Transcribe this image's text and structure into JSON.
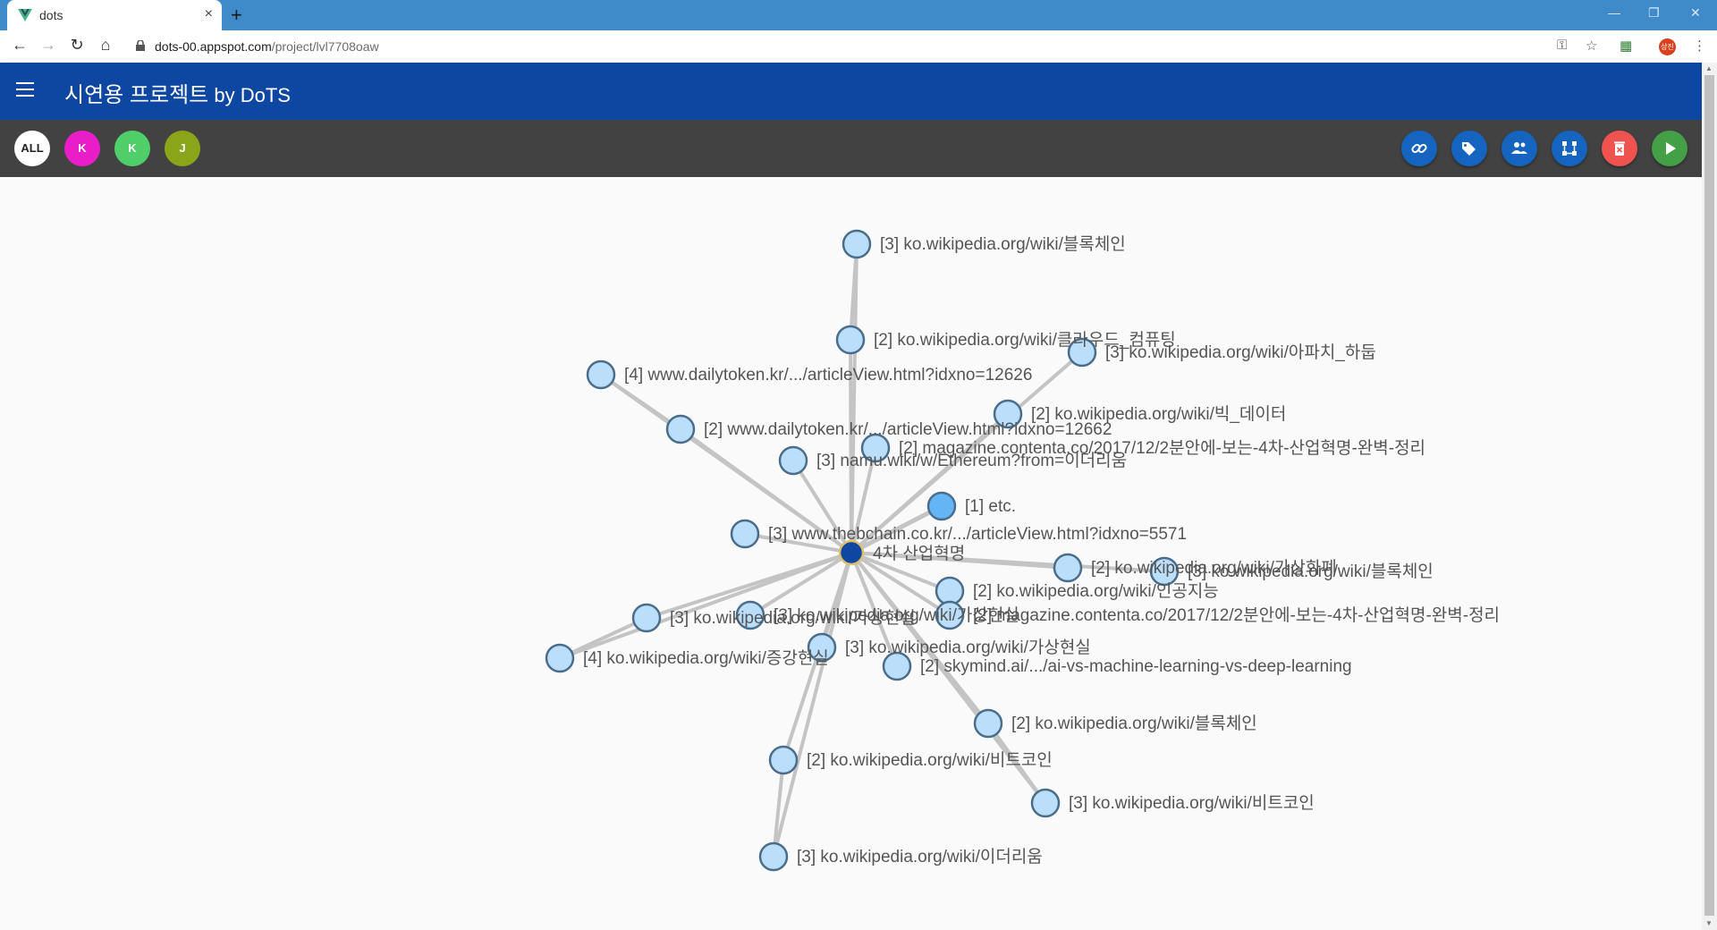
{
  "browser": {
    "tab_title": "dots",
    "tab_close": "×",
    "new_tab": "+",
    "url_host": "dots-00.appspot.com",
    "url_path": "/project/lvl7708oaw",
    "profile_initials": "상진"
  },
  "app": {
    "title_main": "시연용 프로젝트",
    "title_by": " by DoTS"
  },
  "filters": [
    {
      "label": "ALL",
      "color": "#ffffff",
      "text_color": "#222222"
    },
    {
      "label": "K",
      "color": "#e91ec9",
      "text_color": "#ffffff"
    },
    {
      "label": "K",
      "color": "#4fce6a",
      "text_color": "#ffffff"
    },
    {
      "label": "J",
      "color": "#8aa51a",
      "text_color": "#ffffff"
    }
  ],
  "actions": [
    {
      "name": "link-icon",
      "color": "#1565c0"
    },
    {
      "name": "tags-icon",
      "color": "#1565c0"
    },
    {
      "name": "people-icon",
      "color": "#1565c0"
    },
    {
      "name": "flow-icon",
      "color": "#1565c0"
    },
    {
      "name": "delete-icon",
      "color": "#ef5350"
    },
    {
      "name": "play-icon",
      "color": "#43a047"
    }
  ],
  "graph": {
    "center": {
      "label": "4차 산업혁명"
    },
    "nodes": [
      {
        "label": "[3] ko.wikipedia.org/wiki/블록체인",
        "parent": "center",
        "level": 2
      },
      {
        "label": "[2] ko.wikipedia.org/wiki/클라우드_컴퓨팅",
        "parent": "center",
        "level": 2
      },
      {
        "label": "[3] ko.wikipedia.org/wiki/아파치_하둡",
        "parent": "center",
        "level": 2
      },
      {
        "label": "[4] www.dailytoken.kr/.../articleView.html?idxno=12626",
        "parent": "center",
        "level": 2
      },
      {
        "label": "[2] ko.wikipedia.org/wiki/빅_데이터",
        "parent": "center",
        "level": 2
      },
      {
        "label": "[2] www.dailytoken.kr/.../articleView.html?idxno=12662",
        "parent": "center",
        "level": 2
      },
      {
        "label": "[2] magazine.contenta.co/2017/12/2분안에-보는-4차-산업혁명-완벽-정리",
        "parent": "center",
        "level": 2
      },
      {
        "label": "[3] namu.wiki/w/Ethereum?from=이더리움",
        "parent": "center",
        "level": 2
      },
      {
        "label": "[1] etc.",
        "parent": "center",
        "level": 1
      },
      {
        "label": "[3] www.thebchain.co.kr/.../articleView.html?idxno=5571",
        "parent": "center",
        "level": 2
      },
      {
        "label": "[2] ko.wikipedia.org/wiki/가상화폐",
        "parent": "center",
        "level": 2
      },
      {
        "label": "[3] ko.wikipedia.org/wiki/블록체인",
        "parent": "center",
        "level": 2
      },
      {
        "label": "[2] ko.wikipedia.org/wiki/인공지능",
        "parent": "center",
        "level": 2
      },
      {
        "label": "[3] ko.wikipedia.org/wiki/가상현실",
        "parent": "center",
        "level": 2
      },
      {
        "label": "[2] magazine.contenta.co/2017/12/2분안에-보는-4차-산업혁명-완벽-정리",
        "parent": "center",
        "level": 2
      },
      {
        "label": "[3] ko.wikipedia.org/wiki/가상현실",
        "parent": "center",
        "level": 2
      },
      {
        "label": "[4] ko.wikipedia.org/wiki/증강현실",
        "parent": "center",
        "level": 2
      },
      {
        "label": "[3] ko.wikipedia.org/wiki/가상현실",
        "parent": "center",
        "level": 2
      },
      {
        "label": "[2] skymind.ai/.../ai-vs-machine-learning-vs-deep-learning",
        "parent": "center",
        "level": 2
      },
      {
        "label": "[2] ko.wikipedia.org/wiki/블록체인",
        "parent": "center",
        "level": 2
      },
      {
        "label": "[2] ko.wikipedia.org/wiki/비트코인",
        "parent": "center",
        "level": 2
      },
      {
        "label": "[3] ko.wikipedia.org/wiki/비트코인",
        "parent": "center",
        "level": 2
      },
      {
        "label": "[3] ko.wikipedia.org/wiki/이더리움",
        "parent": "center",
        "level": 2
      }
    ]
  }
}
